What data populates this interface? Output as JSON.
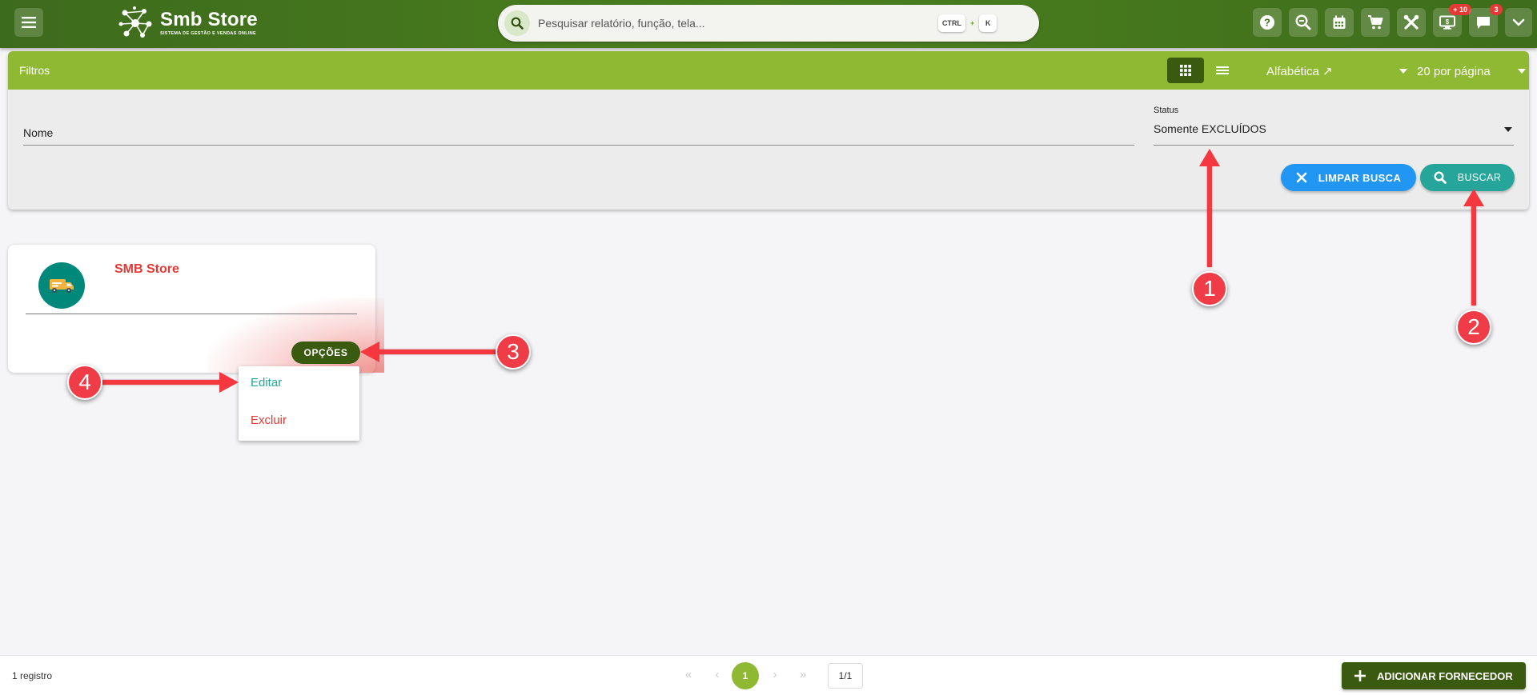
{
  "app": {
    "logo_title": "Smb Store",
    "logo_subtitle": "SISTEMA DE GESTÃO E VENDAS ONLINE"
  },
  "search": {
    "placeholder": "Pesquisar relatório, função, tela...",
    "shortcut_key1": "CTRL",
    "shortcut_plus": "+",
    "shortcut_key2": "K"
  },
  "topbar": {
    "icons": [
      "help-icon",
      "zoom-search-icon",
      "calendar-icon",
      "cart-icon",
      "tools-icon",
      "monitor-icon",
      "chat-icon",
      "chevron-down-icon"
    ],
    "monitor_badge": "+ 10",
    "chat_badge": "3"
  },
  "filters": {
    "title": "Filtros",
    "sort_label": "Alfabética ↗",
    "per_page_label": "20 por página",
    "name_label": "Nome",
    "status_label": "Status",
    "status_value": "Somente EXCLUÍDOS",
    "clear_label": "LIMPAR BUSCA",
    "search_label": "BUSCAR"
  },
  "card": {
    "title": "SMB Store",
    "options_label": "OPÇÕES",
    "menu_items": [
      "Editar",
      "Excluir"
    ]
  },
  "footer": {
    "records": "1 registro",
    "current_page": "1",
    "page_indicator": "1/1",
    "add_label": "ADICIONAR FORNECEDOR"
  },
  "callouts": [
    "1",
    "2",
    "3",
    "4"
  ],
  "colors": {
    "topbar": "#4b7f1f",
    "filter_header": "#8fb932",
    "dark_green": "#3a5a10",
    "blue_button": "#2196f3",
    "teal_button": "#26a69a",
    "accent_red": "#e53935",
    "callout_red": "#f03c46"
  }
}
